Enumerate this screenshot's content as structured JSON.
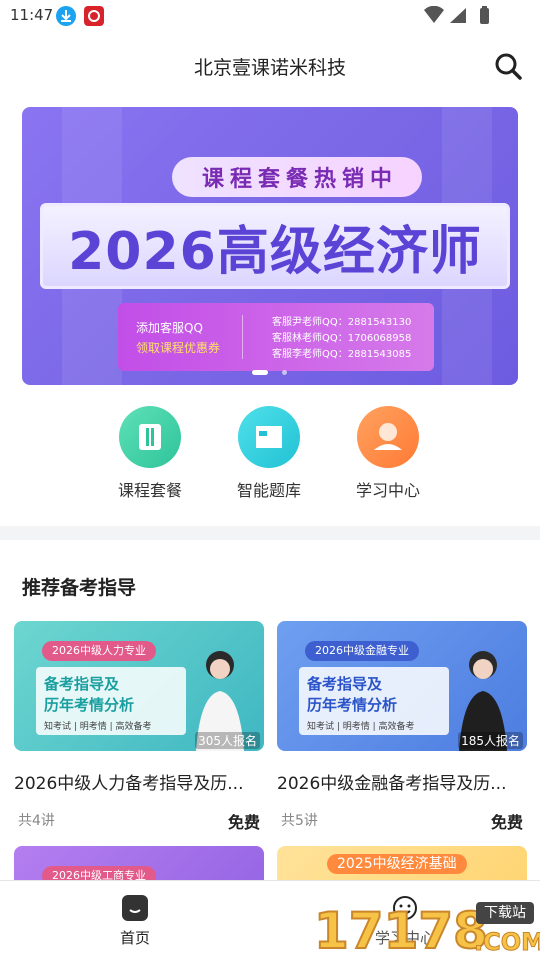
{
  "status_bar": {
    "time": "11:47"
  },
  "header": {
    "title": "北京壹课诺米科技"
  },
  "banner": {
    "pill_chars": [
      "课",
      "程",
      "套",
      "餐",
      "热",
      "销",
      "中"
    ],
    "headline": "2026高级经济师",
    "contact_line1": "添加客服QQ",
    "contact_line2": "领取课程优惠券",
    "qq_lines": [
      "客服尹老师QQ：2881543130",
      "客服林老师QQ：1706068958",
      "客服李老师QQ：2881543085"
    ]
  },
  "quick_entries": [
    {
      "label": "课程套餐",
      "icon": "book-icon"
    },
    {
      "label": "智能题库",
      "icon": "question-bank-icon"
    },
    {
      "label": "学习中心",
      "icon": "learner-icon"
    }
  ],
  "section": {
    "title": "推荐备考指导"
  },
  "courses": [
    {
      "thumb_tag": "2026中级人力专业",
      "thumb_line1": "备考指导及",
      "thumb_line2": "历年考情分析",
      "thumb_line3": "知考试 | 明考情 | 高效备考",
      "signup": "305人报名",
      "title": "2026中级人力备考指导及历...",
      "count": "共4讲",
      "price": "免费"
    },
    {
      "thumb_tag": "2026中级金融专业",
      "thumb_line1": "备考指导及",
      "thumb_line2": "历年考情分析",
      "thumb_line3": "知考试 | 明考情 | 高效备考",
      "signup": "185人报名",
      "title": "2026中级金融备考指导及历...",
      "count": "共5讲",
      "price": "免费"
    },
    {
      "thumb_tag": "2026中级工商专业",
      "thumb_line1": "",
      "thumb_line2": "",
      "thumb_line3": ""
    },
    {
      "thumb_tag": "2025中级经济基础",
      "thumb_line1": "",
      "thumb_line2": "",
      "thumb_line3": ""
    }
  ],
  "bottom_nav": [
    {
      "label": "首页",
      "icon": "home-icon",
      "active": true
    },
    {
      "label": "学习中心",
      "icon": "smile-icon",
      "active": false
    }
  ],
  "watermark": {
    "text": "17178",
    "badge": "下载站",
    "suffix": ".COM"
  },
  "colors": {
    "banner_accent": "#5b43d6",
    "price": "#222222",
    "muted": "#888888"
  }
}
